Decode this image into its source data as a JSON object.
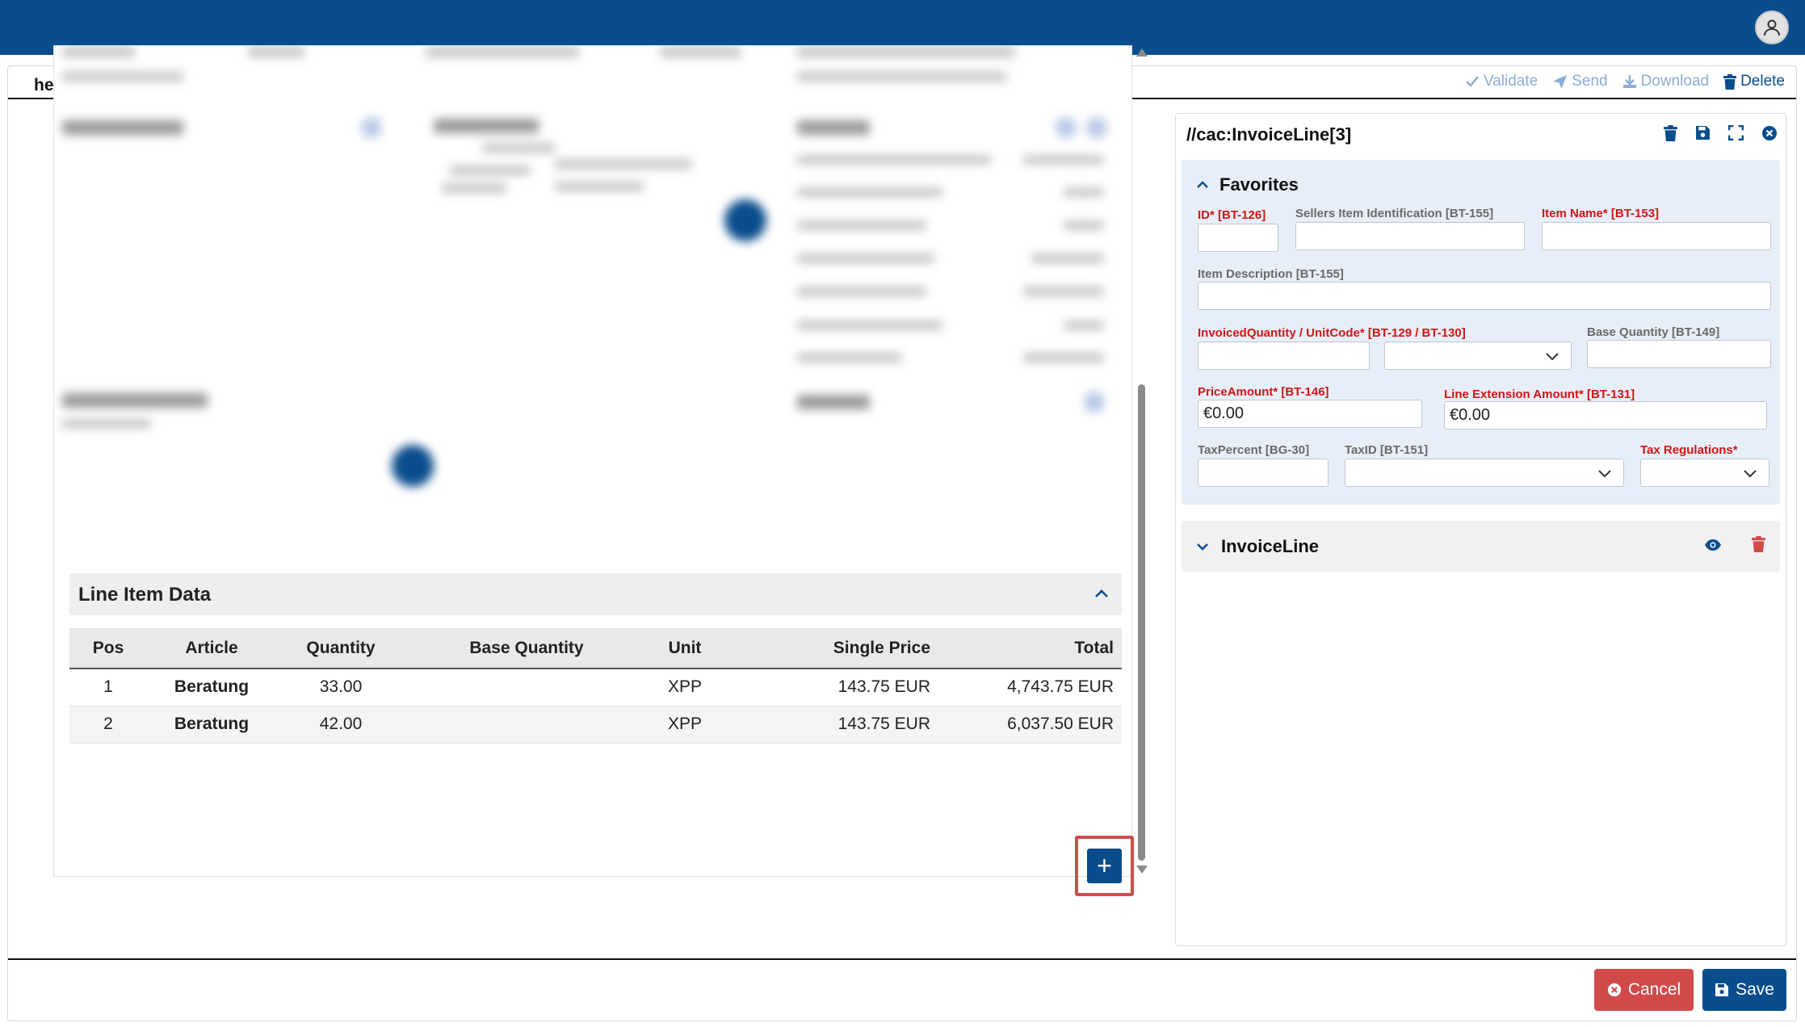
{
  "header": {
    "avatar_icon": "user-icon"
  },
  "document": {
    "filename": "helix.xml"
  },
  "toolbar": {
    "validate": "Validate",
    "send": "Send",
    "download": "Download",
    "delete": "Delete"
  },
  "line_items": {
    "title": "Line Item Data",
    "columns": {
      "pos": "Pos",
      "article": "Article",
      "quantity": "Quantity",
      "base_quantity": "Base Quantity",
      "unit": "Unit",
      "single_price": "Single Price",
      "total": "Total"
    },
    "rows": [
      {
        "pos": "1",
        "article": "Beratung",
        "quantity": "33.00",
        "base_quantity": "",
        "unit": "XPP",
        "single_price": "143.75 EUR",
        "total": "4,743.75 EUR"
      },
      {
        "pos": "2",
        "article": "Beratung",
        "quantity": "42.00",
        "base_quantity": "",
        "unit": "XPP",
        "single_price": "143.75 EUR",
        "total": "6,037.50 EUR"
      }
    ],
    "add_label": "+"
  },
  "editor": {
    "path": "//cac:InvoiceLine[3]",
    "favorites_title": "Favorites",
    "fields": {
      "id": {
        "label": "ID* [BT-126]",
        "value": ""
      },
      "sellers_item_id": {
        "label": "Sellers Item Identification [BT-155]",
        "value": ""
      },
      "item_name": {
        "label": "Item Name* [BT-153]",
        "value": ""
      },
      "item_description": {
        "label": "Item Description [BT-155]",
        "value": ""
      },
      "invoiced_quantity": {
        "label": "InvoicedQuantity / UnitCode* [BT-129 / BT-130]",
        "value": "",
        "unit_code": ""
      },
      "base_quantity": {
        "label": "Base Quantity [BT-149]",
        "value": ""
      },
      "price_amount": {
        "label": "PriceAmount* [BT-146]",
        "value": "€0.00"
      },
      "line_extension_amount": {
        "label": "Line Extension Amount* [BT-131]",
        "value": "€0.00"
      },
      "tax_percent": {
        "label": "TaxPercent [BG-30]",
        "value": ""
      },
      "tax_id": {
        "label": "TaxID [BT-151]",
        "value": ""
      },
      "tax_regulations": {
        "label": "Tax Regulations*",
        "value": ""
      }
    },
    "invoice_line_section": "InvoiceLine"
  },
  "footer": {
    "cancel": "Cancel",
    "save": "Save"
  },
  "colors": {
    "primary": "#0a4d8c",
    "danger": "#d04a4a",
    "required_label": "#d01515"
  }
}
